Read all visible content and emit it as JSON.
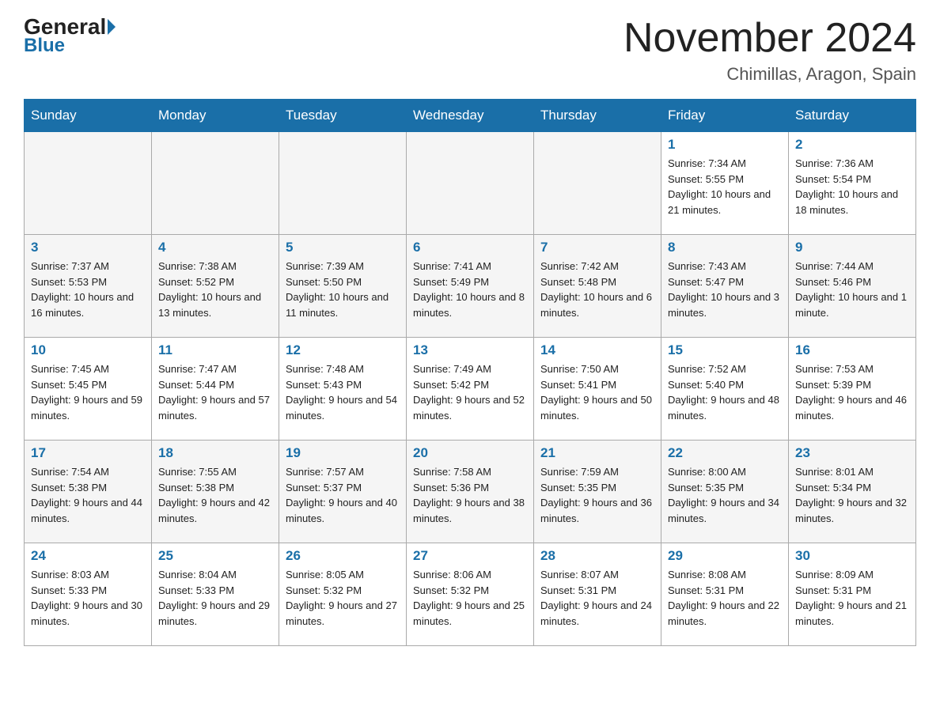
{
  "header": {
    "logo_general": "General",
    "logo_blue": "Blue",
    "title": "November 2024",
    "subtitle": "Chimillas, Aragon, Spain"
  },
  "days_of_week": [
    "Sunday",
    "Monday",
    "Tuesday",
    "Wednesday",
    "Thursday",
    "Friday",
    "Saturday"
  ],
  "weeks": [
    [
      {
        "day": "",
        "sunrise": "",
        "sunset": "",
        "daylight": "",
        "empty": true
      },
      {
        "day": "",
        "sunrise": "",
        "sunset": "",
        "daylight": "",
        "empty": true
      },
      {
        "day": "",
        "sunrise": "",
        "sunset": "",
        "daylight": "",
        "empty": true
      },
      {
        "day": "",
        "sunrise": "",
        "sunset": "",
        "daylight": "",
        "empty": true
      },
      {
        "day": "",
        "sunrise": "",
        "sunset": "",
        "daylight": "",
        "empty": true
      },
      {
        "day": "1",
        "sunrise": "Sunrise: 7:34 AM",
        "sunset": "Sunset: 5:55 PM",
        "daylight": "Daylight: 10 hours and 21 minutes.",
        "empty": false
      },
      {
        "day": "2",
        "sunrise": "Sunrise: 7:36 AM",
        "sunset": "Sunset: 5:54 PM",
        "daylight": "Daylight: 10 hours and 18 minutes.",
        "empty": false
      }
    ],
    [
      {
        "day": "3",
        "sunrise": "Sunrise: 7:37 AM",
        "sunset": "Sunset: 5:53 PM",
        "daylight": "Daylight: 10 hours and 16 minutes.",
        "empty": false
      },
      {
        "day": "4",
        "sunrise": "Sunrise: 7:38 AM",
        "sunset": "Sunset: 5:52 PM",
        "daylight": "Daylight: 10 hours and 13 minutes.",
        "empty": false
      },
      {
        "day": "5",
        "sunrise": "Sunrise: 7:39 AM",
        "sunset": "Sunset: 5:50 PM",
        "daylight": "Daylight: 10 hours and 11 minutes.",
        "empty": false
      },
      {
        "day": "6",
        "sunrise": "Sunrise: 7:41 AM",
        "sunset": "Sunset: 5:49 PM",
        "daylight": "Daylight: 10 hours and 8 minutes.",
        "empty": false
      },
      {
        "day": "7",
        "sunrise": "Sunrise: 7:42 AM",
        "sunset": "Sunset: 5:48 PM",
        "daylight": "Daylight: 10 hours and 6 minutes.",
        "empty": false
      },
      {
        "day": "8",
        "sunrise": "Sunrise: 7:43 AM",
        "sunset": "Sunset: 5:47 PM",
        "daylight": "Daylight: 10 hours and 3 minutes.",
        "empty": false
      },
      {
        "day": "9",
        "sunrise": "Sunrise: 7:44 AM",
        "sunset": "Sunset: 5:46 PM",
        "daylight": "Daylight: 10 hours and 1 minute.",
        "empty": false
      }
    ],
    [
      {
        "day": "10",
        "sunrise": "Sunrise: 7:45 AM",
        "sunset": "Sunset: 5:45 PM",
        "daylight": "Daylight: 9 hours and 59 minutes.",
        "empty": false
      },
      {
        "day": "11",
        "sunrise": "Sunrise: 7:47 AM",
        "sunset": "Sunset: 5:44 PM",
        "daylight": "Daylight: 9 hours and 57 minutes.",
        "empty": false
      },
      {
        "day": "12",
        "sunrise": "Sunrise: 7:48 AM",
        "sunset": "Sunset: 5:43 PM",
        "daylight": "Daylight: 9 hours and 54 minutes.",
        "empty": false
      },
      {
        "day": "13",
        "sunrise": "Sunrise: 7:49 AM",
        "sunset": "Sunset: 5:42 PM",
        "daylight": "Daylight: 9 hours and 52 minutes.",
        "empty": false
      },
      {
        "day": "14",
        "sunrise": "Sunrise: 7:50 AM",
        "sunset": "Sunset: 5:41 PM",
        "daylight": "Daylight: 9 hours and 50 minutes.",
        "empty": false
      },
      {
        "day": "15",
        "sunrise": "Sunrise: 7:52 AM",
        "sunset": "Sunset: 5:40 PM",
        "daylight": "Daylight: 9 hours and 48 minutes.",
        "empty": false
      },
      {
        "day": "16",
        "sunrise": "Sunrise: 7:53 AM",
        "sunset": "Sunset: 5:39 PM",
        "daylight": "Daylight: 9 hours and 46 minutes.",
        "empty": false
      }
    ],
    [
      {
        "day": "17",
        "sunrise": "Sunrise: 7:54 AM",
        "sunset": "Sunset: 5:38 PM",
        "daylight": "Daylight: 9 hours and 44 minutes.",
        "empty": false
      },
      {
        "day": "18",
        "sunrise": "Sunrise: 7:55 AM",
        "sunset": "Sunset: 5:38 PM",
        "daylight": "Daylight: 9 hours and 42 minutes.",
        "empty": false
      },
      {
        "day": "19",
        "sunrise": "Sunrise: 7:57 AM",
        "sunset": "Sunset: 5:37 PM",
        "daylight": "Daylight: 9 hours and 40 minutes.",
        "empty": false
      },
      {
        "day": "20",
        "sunrise": "Sunrise: 7:58 AM",
        "sunset": "Sunset: 5:36 PM",
        "daylight": "Daylight: 9 hours and 38 minutes.",
        "empty": false
      },
      {
        "day": "21",
        "sunrise": "Sunrise: 7:59 AM",
        "sunset": "Sunset: 5:35 PM",
        "daylight": "Daylight: 9 hours and 36 minutes.",
        "empty": false
      },
      {
        "day": "22",
        "sunrise": "Sunrise: 8:00 AM",
        "sunset": "Sunset: 5:35 PM",
        "daylight": "Daylight: 9 hours and 34 minutes.",
        "empty": false
      },
      {
        "day": "23",
        "sunrise": "Sunrise: 8:01 AM",
        "sunset": "Sunset: 5:34 PM",
        "daylight": "Daylight: 9 hours and 32 minutes.",
        "empty": false
      }
    ],
    [
      {
        "day": "24",
        "sunrise": "Sunrise: 8:03 AM",
        "sunset": "Sunset: 5:33 PM",
        "daylight": "Daylight: 9 hours and 30 minutes.",
        "empty": false
      },
      {
        "day": "25",
        "sunrise": "Sunrise: 8:04 AM",
        "sunset": "Sunset: 5:33 PM",
        "daylight": "Daylight: 9 hours and 29 minutes.",
        "empty": false
      },
      {
        "day": "26",
        "sunrise": "Sunrise: 8:05 AM",
        "sunset": "Sunset: 5:32 PM",
        "daylight": "Daylight: 9 hours and 27 minutes.",
        "empty": false
      },
      {
        "day": "27",
        "sunrise": "Sunrise: 8:06 AM",
        "sunset": "Sunset: 5:32 PM",
        "daylight": "Daylight: 9 hours and 25 minutes.",
        "empty": false
      },
      {
        "day": "28",
        "sunrise": "Sunrise: 8:07 AM",
        "sunset": "Sunset: 5:31 PM",
        "daylight": "Daylight: 9 hours and 24 minutes.",
        "empty": false
      },
      {
        "day": "29",
        "sunrise": "Sunrise: 8:08 AM",
        "sunset": "Sunset: 5:31 PM",
        "daylight": "Daylight: 9 hours and 22 minutes.",
        "empty": false
      },
      {
        "day": "30",
        "sunrise": "Sunrise: 8:09 AM",
        "sunset": "Sunset: 5:31 PM",
        "daylight": "Daylight: 9 hours and 21 minutes.",
        "empty": false
      }
    ]
  ]
}
